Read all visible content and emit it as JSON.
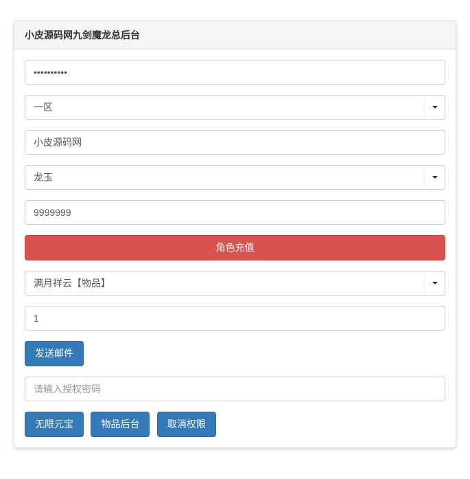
{
  "panel": {
    "title": "小皮源码网九剑魔龙总后台"
  },
  "fields": {
    "password": {
      "value": "••••••••••"
    },
    "zone": {
      "selected": "一区"
    },
    "account": {
      "value": "小皮源码网"
    },
    "character": {
      "selected": "龙玉"
    },
    "amount": {
      "value": "9999999"
    },
    "rechargeButton": "角色充值",
    "item": {
      "selected": "满月祥云【物品】"
    },
    "quantity": {
      "value": "1"
    },
    "sendMailButton": "发送邮件",
    "authPassword": {
      "placeholder": "请输入授权密码"
    },
    "actionButtons": {
      "unlimited": "无限元宝",
      "itemBackend": "物品后台",
      "cancelAuth": "取消权限"
    }
  }
}
